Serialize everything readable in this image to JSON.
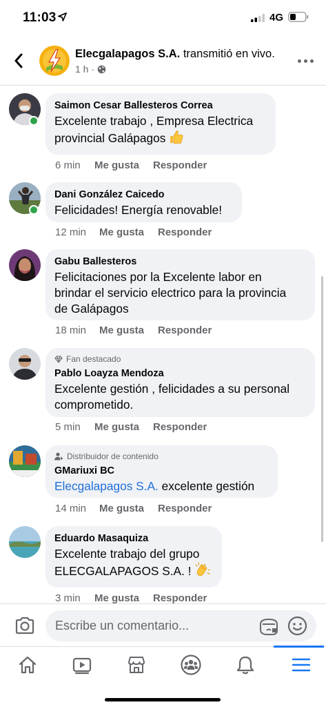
{
  "status": {
    "time": "11:03",
    "network": "4G"
  },
  "header": {
    "page_name": "Elecgalapagos S.A.",
    "action": "transmitió en vivo.",
    "time": "1 h"
  },
  "comments": [
    {
      "author": "Saimon Cesar Ballesteros Correa",
      "lines": [
        "Excelente trabajo , Empresa Electrica",
        "provincial Galápagos"
      ],
      "emoji": "thumbs-up-emoji",
      "time": "6 min",
      "like": "Me gusta",
      "reply": "Responder",
      "online": true
    },
    {
      "author": "Dani González Caicedo",
      "lines": [
        "Felicidades! Energía renovable!"
      ],
      "time": "12 min",
      "like": "Me gusta",
      "reply": "Responder",
      "online": true
    },
    {
      "author": "Gabu Ballesteros",
      "lines": [
        "Felicitaciones por la Excelente labor en",
        "brindar el servicio electrico para la provincia",
        "de Galápagos"
      ],
      "time": "18 min",
      "like": "Me gusta",
      "reply": "Responder",
      "online": false
    },
    {
      "badge": "Fan destacado",
      "author": "Pablo Loayza Mendoza",
      "lines": [
        "Excelente gestión , felicidades a su personal",
        "comprometido."
      ],
      "time": "5 min",
      "like": "Me gusta",
      "reply": "Responder",
      "online": false
    },
    {
      "badge": "Distribuidor de contenido",
      "author": "GMariuxi BC",
      "mention": "Elecgalapagos S.A.",
      "lines": [
        "excelente gestión"
      ],
      "time": "14 min",
      "like": "Me gusta",
      "reply": "Responder",
      "online": false
    },
    {
      "author": "Eduardo Masaquiza",
      "lines": [
        "Excelente trabajo del grupo",
        "ELECGALAPAGOS S.A. !"
      ],
      "emoji": "clapping-hands-emoji",
      "time": "3 min",
      "like": "Me gusta",
      "reply": "Responder",
      "online": false
    }
  ],
  "composer": {
    "placeholder": "Escribe un comentario..."
  },
  "tabs": [
    {
      "icon": "home-icon"
    },
    {
      "icon": "video-icon"
    },
    {
      "icon": "marketplace-icon"
    },
    {
      "icon": "groups-icon"
    },
    {
      "icon": "bell-icon"
    },
    {
      "icon": "menu-icon",
      "active": true
    }
  ],
  "colors": {
    "accent": "#1877f2",
    "bubble": "#f0f2f5",
    "secondary_text": "#65676b",
    "mention": "#216fdb",
    "online": "#31a24c"
  }
}
